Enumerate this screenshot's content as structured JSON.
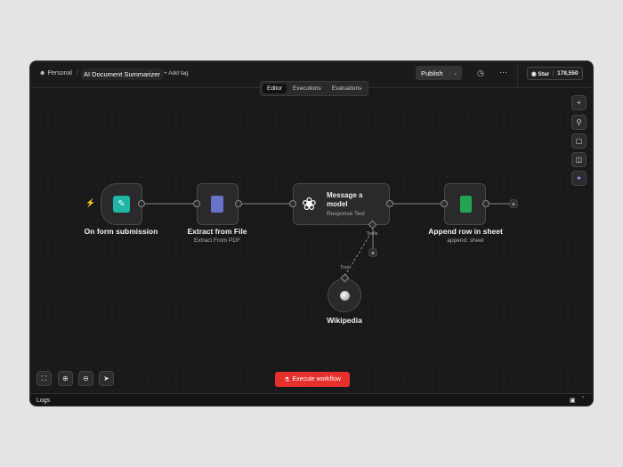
{
  "header": {
    "workspace": "Personal",
    "workflow_name": "AI Document Summarizer",
    "add_tag": "+ Add tag",
    "publish": "Publish",
    "star": "Star",
    "star_count": "178,550"
  },
  "tabs": [
    {
      "label": "Editor",
      "active": true
    },
    {
      "label": "Executions"
    },
    {
      "label": "Evaluations"
    }
  ],
  "nodes": {
    "trigger": {
      "title": "On form submission"
    },
    "extract": {
      "title": "Extract from File",
      "subtitle": "Extract From PDF"
    },
    "model": {
      "title": "Message a model",
      "subtitle": "Response Text",
      "port_label": "Tools"
    },
    "append": {
      "title": "Append row in sheet",
      "subtitle": "append: sheet"
    },
    "wiki": {
      "title": "Wikipedia",
      "port_label": "Tool"
    }
  },
  "execute": "Execute workflow",
  "logs": "Logs",
  "colors": {
    "execute": "#e5302c",
    "accent": "#7c5cff"
  }
}
